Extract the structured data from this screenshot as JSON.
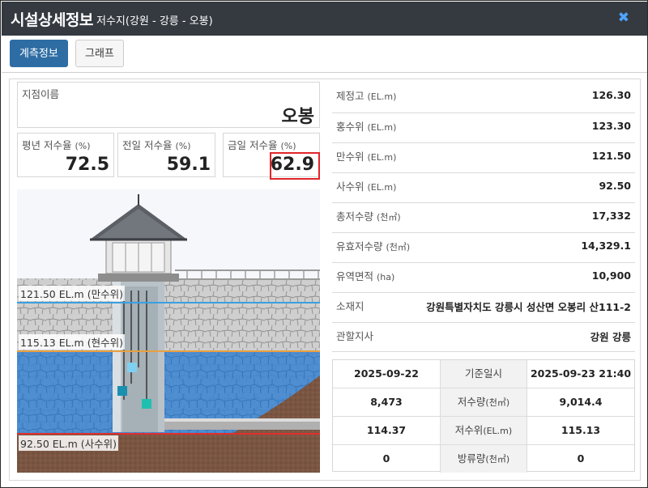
{
  "header": {
    "title": "시설상세정보",
    "subtitle": "저수지(강원 - 강릉 - 오봉)",
    "close_icon": "close-icon"
  },
  "tabs": [
    {
      "label": "계측정보",
      "active": true
    },
    {
      "label": "그래프",
      "active": false
    }
  ],
  "station": {
    "label": "지점이름",
    "value": "오봉"
  },
  "rates": [
    {
      "label": "평년 저수율",
      "unit": "(%)",
      "value": "72.5"
    },
    {
      "label": "전일 저수율",
      "unit": "(%)",
      "value": "59.1"
    },
    {
      "label": "금일 저수율",
      "unit": "(%)",
      "value": "62.9"
    }
  ],
  "levels": {
    "full": "121.50 EL.m (만수위)",
    "current": "115.13 EL.m (현수위)",
    "dead": "92.50 EL.m (사수위)",
    "current_fraction": 0.77
  },
  "info": [
    {
      "label": "제정고",
      "unit": "(EL.m)",
      "value": "126.30"
    },
    {
      "label": "홍수위",
      "unit": "(EL.m)",
      "value": "123.30"
    },
    {
      "label": "만수위",
      "unit": "(EL.m)",
      "value": "121.50"
    },
    {
      "label": "사수위",
      "unit": "(EL.m)",
      "value": "92.50"
    },
    {
      "label": "총저수량",
      "unit": "(천㎥)",
      "value": "17,332"
    },
    {
      "label": "유효저수량",
      "unit": "(천㎥)",
      "value": "14,329.1"
    },
    {
      "label": "유역면적",
      "unit": "(ha)",
      "value": "10,900"
    },
    {
      "label": "소재지",
      "unit": "",
      "value": "강원특별자치도 강릉시 성산면 오봉리 산111-2"
    },
    {
      "label": "관할지사",
      "unit": "",
      "value": "강원 강릉"
    }
  ],
  "measurement": {
    "prev_date": "2025-09-22",
    "ref_label": "기준일시",
    "cur_datetime": "2025-09-23 21:40",
    "rows": [
      {
        "prev": "8,473",
        "label": "저수량",
        "unit": "(천㎥)",
        "cur": "9,014.4"
      },
      {
        "prev": "114.37",
        "label": "저수위",
        "unit": "(EL.m)",
        "cur": "115.13"
      },
      {
        "prev": "0",
        "label": "방류량",
        "unit": "(천㎥)",
        "cur": "0"
      }
    ]
  },
  "colors": {
    "header_bg": "#343a40",
    "tab_active": "#2e6da4",
    "highlight": "#e0252a",
    "full_line": "#3aa0e0",
    "current_line": "#e8a040",
    "dead_line": "#e03030",
    "water": "#3f86d0"
  }
}
